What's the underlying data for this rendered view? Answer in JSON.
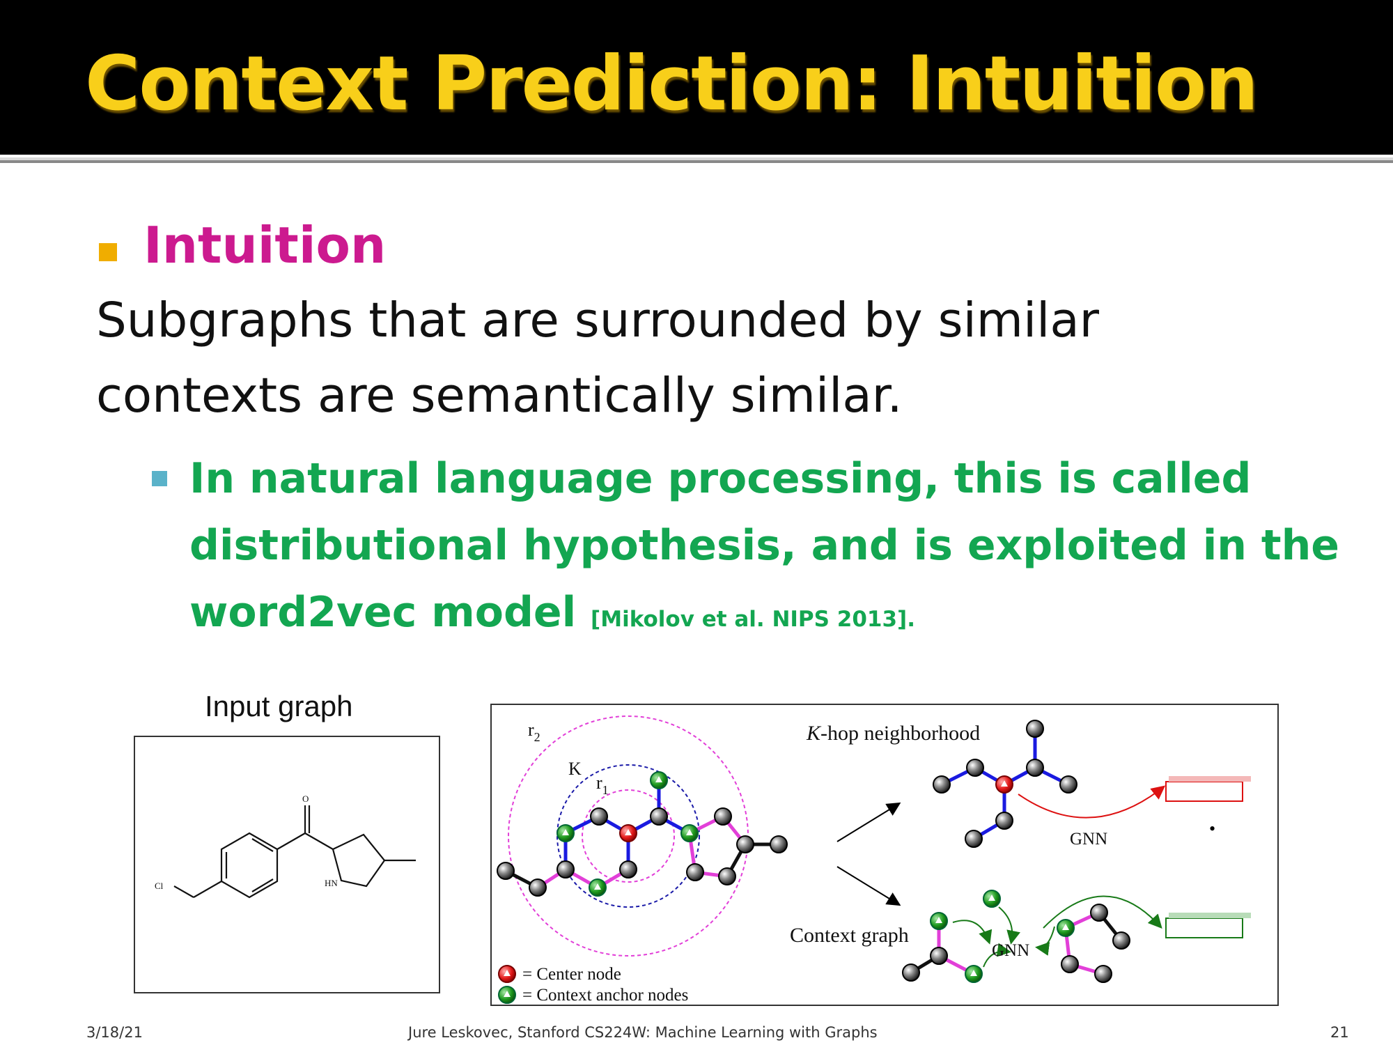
{
  "slide": {
    "title": "Context Prediction: Intuition",
    "heading": "Intuition",
    "body_line1": "Subgraphs that are surrounded by similar",
    "body_line2": "contexts are semantically similar.",
    "sub_line1": "In natural language processing, this is called",
    "sub_line2": "distributional hypothesis, and is exploited in the",
    "sub_line3": "word2vec model",
    "citation": "[Mikolov et al. NIPS 2013].",
    "colors": {
      "title": "#f8cf1a",
      "heading": "#cc1a8f",
      "sub": "#13a651",
      "bullet1": "#f0ad00",
      "bullet2": "#5ab2c9"
    }
  },
  "figure": {
    "input_caption": "Input graph",
    "molecule_labels": {
      "oxygen": "O",
      "chlorine": "Cl",
      "amine": "HN"
    },
    "diagram": {
      "r2": "r",
      "r2_sub": "2",
      "k": "K",
      "r1": "r",
      "r1_sub": "1",
      "khop_k": "K",
      "khop_rest": "-hop neighborhood",
      "context_graph": "Context graph",
      "gnn_top": "GNN",
      "gnn_bottom": "GNN",
      "dot": "•",
      "legend_center": "=  Center node",
      "legend_anchor": "=  Context anchor nodes"
    }
  },
  "footer": {
    "date": "3/18/21",
    "credit": "Jure Leskovec, Stanford CS224W: Machine Learning with Graphs",
    "page": "21"
  }
}
